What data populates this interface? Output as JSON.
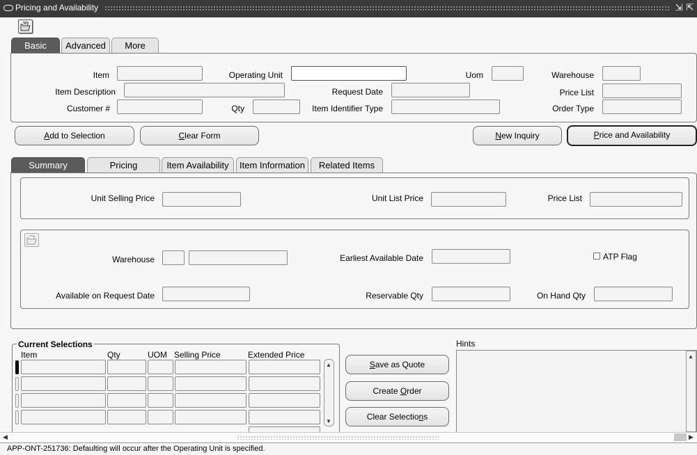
{
  "window": {
    "title": "Pricing and Availability",
    "minimize_glyph": "⇲",
    "maximize_glyph": "⇱"
  },
  "icons": {
    "folder": "open-folder-icon",
    "menu": "window-menu-icon"
  },
  "top_tabs": [
    "Basic",
    "Advanced",
    "More"
  ],
  "criteria": {
    "item_label": "Item",
    "operating_unit_label": "Operating Unit",
    "uom_label": "Uom",
    "warehouse_label": "Warehouse",
    "item_description_label": "Item Description",
    "request_date_label": "Request Date",
    "price_list_label": "Price List",
    "customer_label": "Customer #",
    "qty_label": "Qty",
    "item_identifier_type_label": "Item Identifier Type",
    "order_type_label": "Order Type"
  },
  "buttons": {
    "add_to_selection_prefix": "",
    "add_to_selection_u": "A",
    "add_to_selection_rest": "dd to Selection",
    "clear_form_prefix": "",
    "clear_form_u": "C",
    "clear_form_rest": "lear Form",
    "new_inquiry_prefix": "",
    "new_inquiry_u": "N",
    "new_inquiry_rest": "ew Inquiry",
    "price_avail_prefix": "",
    "price_avail_u": "P",
    "price_avail_rest": "rice and Availability",
    "save_quote_prefix": "",
    "save_quote_u": "S",
    "save_quote_rest": "ave as Quote",
    "create_order_prefix": "Create ",
    "create_order_u": "O",
    "create_order_rest": "rder",
    "clear_sel_prefix": "Clear Selectio",
    "clear_sel_u": "n",
    "clear_sel_rest": "s"
  },
  "result_tabs": [
    "Summary",
    "Pricing",
    "Item Availability",
    "Item Information",
    "Related Items"
  ],
  "summary": {
    "unit_selling_price_label": "Unit Selling Price",
    "unit_list_price_label": "Unit List Price",
    "price_list_label": "Price List",
    "warehouse_label": "Warehouse",
    "earliest_available_date_label": "Earliest Available Date",
    "atp_flag_label": "ATP Flag",
    "available_on_request_date_label": "Available on Request Date",
    "reservable_qty_label": "Reservable Qty",
    "on_hand_qty_label": "On Hand Qty"
  },
  "current_selections": {
    "title": "Current Selections",
    "columns": [
      "Item",
      "Qty",
      "UOM",
      "Selling Price",
      "Extended Price"
    ],
    "row_count": 4
  },
  "hints": {
    "label": "Hints"
  },
  "status": {
    "message": "APP-ONT-251736: Defaulting will occur after the Operating Unit is specified."
  }
}
